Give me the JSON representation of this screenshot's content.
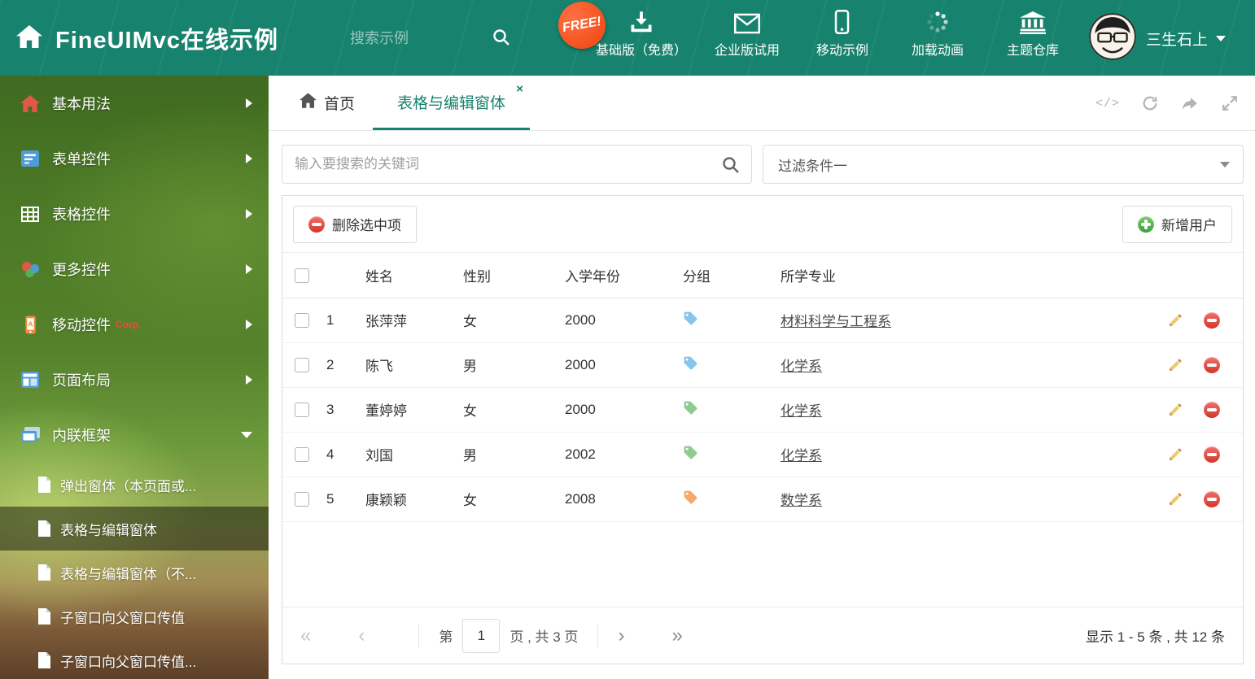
{
  "header": {
    "title": "FineUIMvc在线示例",
    "search_placeholder": "搜索示例",
    "free_badge": "FREE!",
    "nav": [
      {
        "label": "基础版（免费）"
      },
      {
        "label": "企业版试用"
      },
      {
        "label": "移动示例"
      },
      {
        "label": "加载动画"
      },
      {
        "label": "主题仓库"
      }
    ],
    "user_name": "三生石上"
  },
  "sidebar": {
    "items": [
      {
        "label": "基本用法"
      },
      {
        "label": "表单控件"
      },
      {
        "label": "表格控件"
      },
      {
        "label": "更多控件"
      },
      {
        "label": "移动控件",
        "badge": "Corp."
      },
      {
        "label": "页面布局"
      },
      {
        "label": "内联框架"
      }
    ],
    "subitems": [
      {
        "label": "弹出窗体（本页面或..."
      },
      {
        "label": "表格与编辑窗体"
      },
      {
        "label": "表格与编辑窗体（不..."
      },
      {
        "label": "子窗口向父窗口传值"
      },
      {
        "label": "子窗口向父窗口传值..."
      }
    ]
  },
  "tabs": {
    "home": "首页",
    "active": "表格与编辑窗体",
    "close_glyph": "×"
  },
  "tools": {
    "code_glyph": "</>"
  },
  "content": {
    "search_placeholder": "输入要搜索的关键词",
    "filter_value": "过滤条件一",
    "delete_button": "删除选中项",
    "add_button": "新增用户",
    "table": {
      "columns": [
        "姓名",
        "性别",
        "入学年份",
        "分组",
        "所学专业"
      ],
      "rows": [
        {
          "num": "1",
          "name": "张萍萍",
          "gender": "女",
          "year": "2000",
          "tag_color": "#86c5ec",
          "major": "材料科学与工程系"
        },
        {
          "num": "2",
          "name": "陈飞",
          "gender": "男",
          "year": "2000",
          "tag_color": "#86c5ec",
          "major": "化学系"
        },
        {
          "num": "3",
          "name": "董婷婷",
          "gender": "女",
          "year": "2000",
          "tag_color": "#8fcb90",
          "major": "化学系"
        },
        {
          "num": "4",
          "name": "刘国",
          "gender": "男",
          "year": "2002",
          "tag_color": "#8fcb90",
          "major": "化学系"
        },
        {
          "num": "5",
          "name": "康颖颖",
          "gender": "女",
          "year": "2008",
          "tag_color": "#f4aa6e",
          "major": "数学系"
        }
      ]
    },
    "pagination": {
      "first_glyph": "«",
      "prev_glyph": "‹",
      "next_glyph": "›",
      "last_glyph": "»",
      "page_prefix": "第",
      "current_page": "1",
      "page_suffix": "页 , 共 3 页",
      "summary": "显示 1 - 5 条 , 共 12 条"
    }
  }
}
